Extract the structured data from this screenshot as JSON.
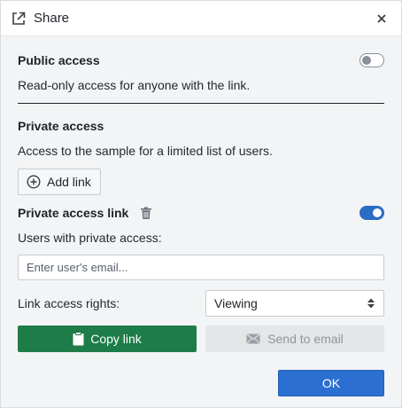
{
  "dialog": {
    "title": "Share",
    "icons": {
      "title": "external-link-icon",
      "close": "close-icon"
    }
  },
  "public_access": {
    "heading": "Public access",
    "description": "Read-only access for anyone with the link.",
    "enabled": false
  },
  "private_access": {
    "heading": "Private access",
    "description": "Access to the sample for a limited list of users.",
    "add_link_label": "Add link",
    "link": {
      "heading": "Private access link",
      "enabled": true,
      "users_label": "Users with private access:",
      "email_placeholder": "Enter user's email...",
      "email_value": "",
      "rights_label": "Link access rights:",
      "rights_selected": "Viewing",
      "copy_link_label": "Copy link",
      "send_email_label": "Send to email"
    }
  },
  "footer": {
    "ok_label": "OK"
  },
  "colors": {
    "primary": "#2b70d1",
    "success": "#1e7c48",
    "toggle_on": "#2b6cc4"
  }
}
